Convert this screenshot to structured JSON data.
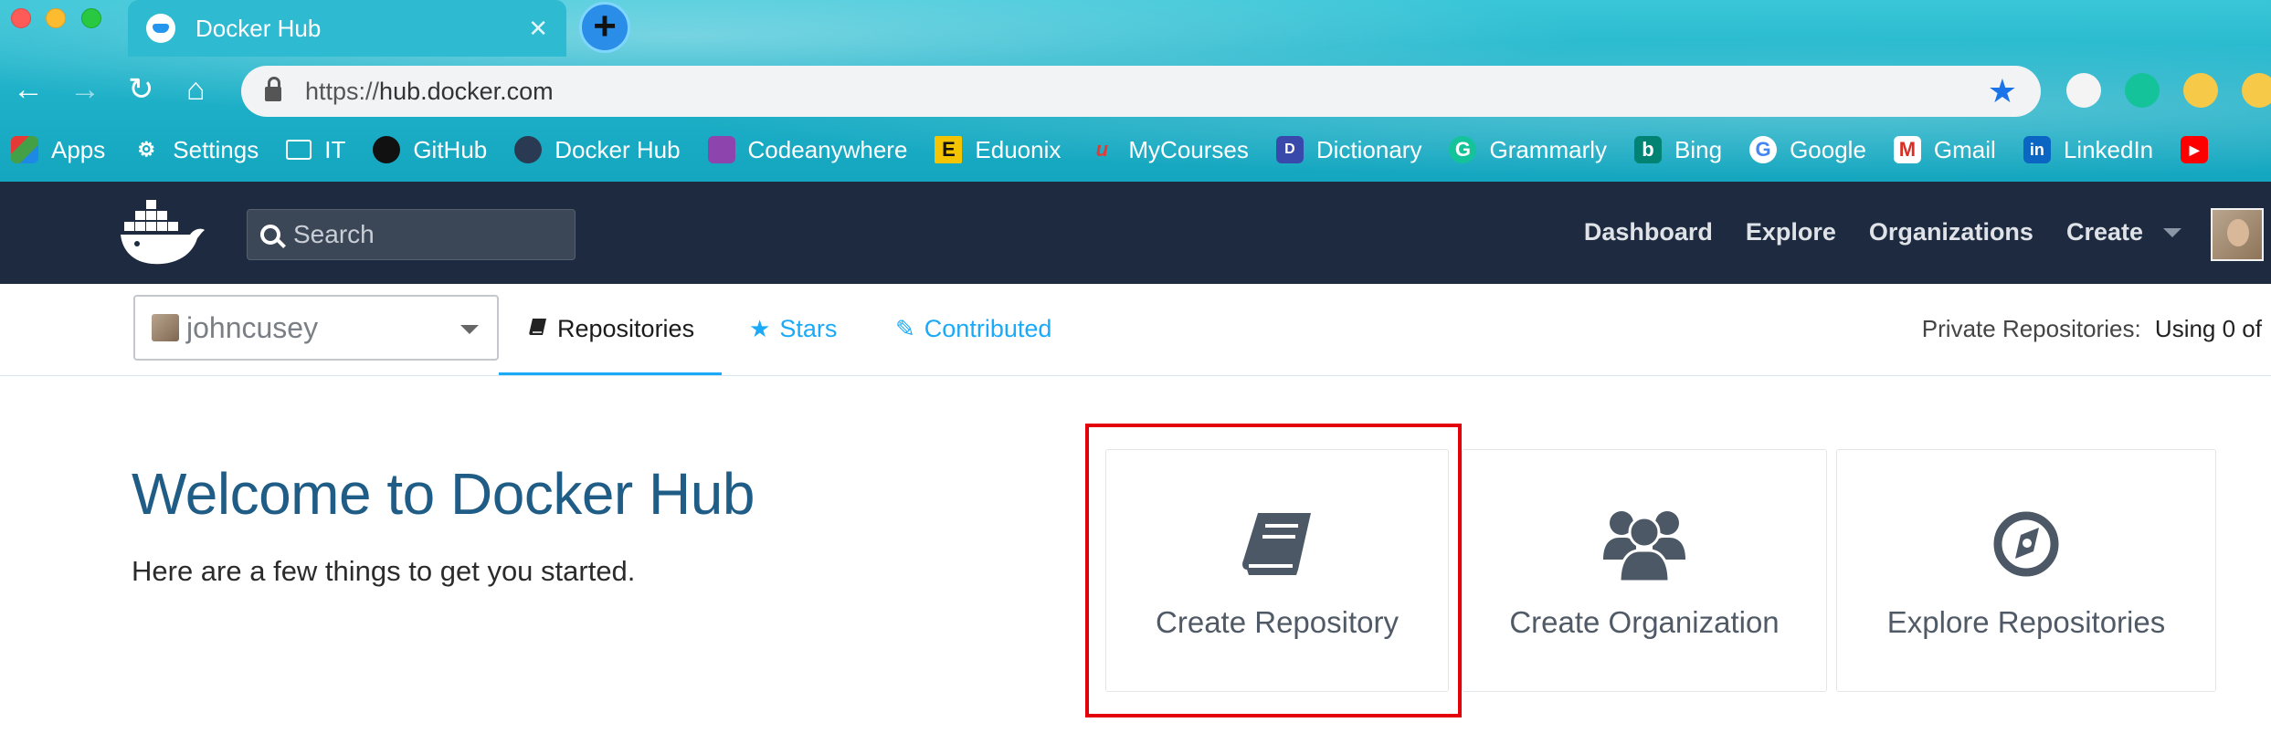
{
  "browser": {
    "tab_title": "Docker Hub",
    "tab_close": "✕",
    "new_tab": "+",
    "url_scheme": "https://",
    "url_host": "hub.docker.com",
    "nav": {
      "back": "←",
      "forward": "→",
      "reload": "↻",
      "home": "⌂"
    },
    "star": "★"
  },
  "bookmarks": [
    {
      "label": "Apps",
      "icon": "apps-grid-icon"
    },
    {
      "label": "Settings",
      "icon": "gear-icon"
    },
    {
      "label": "IT",
      "icon": "folder-icon"
    },
    {
      "label": "GitHub",
      "icon": "github-icon"
    },
    {
      "label": "Docker Hub",
      "icon": "docker-icon"
    },
    {
      "label": "Codeanywhere",
      "icon": "codeanywhere-icon"
    },
    {
      "label": "Eduonix",
      "icon": "eduonix-icon"
    },
    {
      "label": "MyCourses",
      "icon": "mycourses-icon"
    },
    {
      "label": "Dictionary",
      "icon": "dictionary-icon"
    },
    {
      "label": "Grammarly",
      "icon": "grammarly-icon"
    },
    {
      "label": "Bing",
      "icon": "bing-icon"
    },
    {
      "label": "Google",
      "icon": "google-icon"
    },
    {
      "label": "Gmail",
      "icon": "gmail-icon"
    },
    {
      "label": "LinkedIn",
      "icon": "linkedin-icon"
    }
  ],
  "header": {
    "search_placeholder": "Search",
    "nav": {
      "dashboard": "Dashboard",
      "explore": "Explore",
      "organizations": "Organizations",
      "create": "Create"
    }
  },
  "subnav": {
    "account": "johncusey",
    "tabs": {
      "repositories": "Repositories",
      "stars": "Stars",
      "contributed": "Contributed"
    },
    "private_label": "Private Repositories:",
    "private_value": "Using 0 of"
  },
  "main": {
    "welcome_title": "Welcome to Docker Hub",
    "welcome_sub": "Here are a few things to get you started.",
    "cards": [
      {
        "label": "Create Repository",
        "icon": "book-icon"
      },
      {
        "label": "Create Organization",
        "icon": "users-icon"
      },
      {
        "label": "Explore Repositories",
        "icon": "compass-icon"
      }
    ]
  },
  "colors": {
    "docker_header": "#1d2a3f",
    "accent": "#1aaaf8",
    "welcome_title": "#1f5c86",
    "highlight": "#e3000b"
  }
}
